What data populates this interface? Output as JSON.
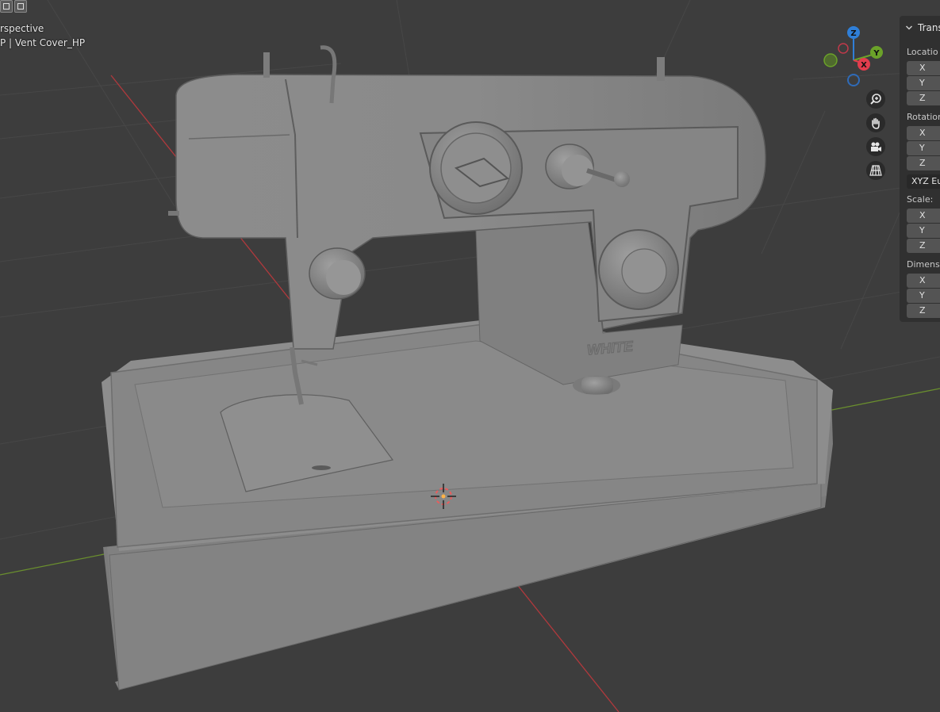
{
  "viewport": {
    "view_name": "rspective",
    "object_info": "P | Vent Cover_HP",
    "product_badge": "WHITE"
  },
  "gizmo": {
    "axis_z": "Z",
    "axis_y": "Y",
    "axis_x": "X"
  },
  "nav_buttons": [
    "zoom-icon",
    "hand-pan-icon",
    "camera-icon",
    "grid-perspective-icon"
  ],
  "npanel": {
    "header": "Transf",
    "location_label": "Locatio",
    "rotation_label": "Rotation",
    "rotation_mode": "XYZ Eu",
    "scale_label": "Scale:",
    "dimensions_label": "Dimensi",
    "axis_x": "X",
    "axis_y": "Y",
    "axis_z": "Z"
  },
  "colors": {
    "background": "#3d3d3d",
    "grid": "#474747",
    "axis_x": "#b0393d",
    "axis_y": "#6a8f2e",
    "gizmo_z": "#2f7fd8",
    "gizmo_y": "#6ba229",
    "gizmo_x": "#e23d4d"
  }
}
